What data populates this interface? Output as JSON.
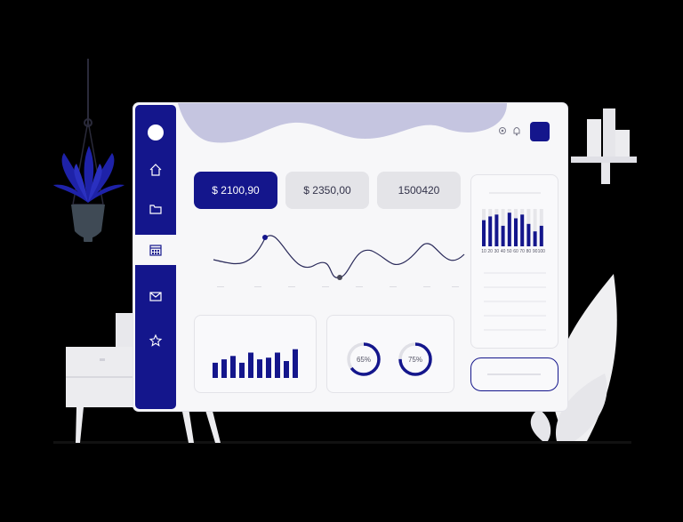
{
  "stats": [
    {
      "value": "$ 2100,90"
    },
    {
      "value": "$ 2350,00"
    },
    {
      "value": "1500420"
    }
  ],
  "donuts": [
    {
      "label": "65%",
      "value": 0.65
    },
    {
      "label": "75%",
      "value": 0.75
    }
  ],
  "mini_bar_chart": {
    "values": [
      0.45,
      0.55,
      0.65,
      0.45,
      0.75,
      0.55,
      0.6,
      0.75,
      0.5,
      0.85
    ],
    "track_color": "#e6e6ea",
    "bar_color": "#14168c"
  },
  "side_bar_chart": {
    "x_labels": [
      "10",
      "20",
      "30",
      "40",
      "50",
      "60",
      "70",
      "80",
      "90",
      "100"
    ],
    "values": [
      0.7,
      0.8,
      0.85,
      0.55,
      0.9,
      0.75,
      0.85,
      0.6,
      0.4,
      0.55
    ],
    "bar_color": "#14168c",
    "track_color": "#e6e6ea"
  },
  "sidebar": {
    "items": [
      {
        "icon": "home-icon"
      },
      {
        "icon": "folder-icon"
      },
      {
        "icon": "calendar-icon",
        "active": true
      },
      {
        "icon": "mail-icon"
      },
      {
        "icon": "star-icon"
      }
    ]
  },
  "top_icons": [
    "settings-icon",
    "bell-icon"
  ],
  "colors": {
    "primary": "#14168c",
    "blob": "#c5c5e0",
    "panel_bg": "#f7f7f9",
    "plant_leaves": "#1e22a8",
    "pot": "#3f4a55"
  }
}
